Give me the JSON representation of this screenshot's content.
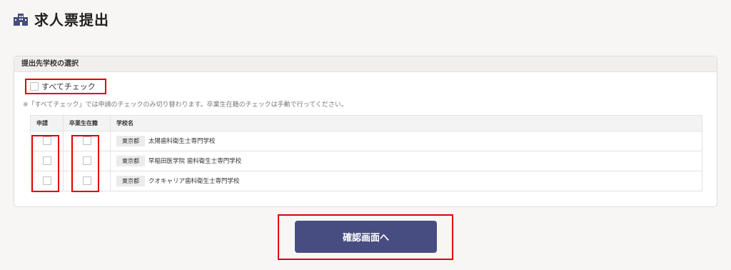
{
  "page": {
    "title": "求人票提出",
    "icon": "building-icon"
  },
  "panel": {
    "heading": "提出先学校の選択",
    "check_all_label": "すべてチェック",
    "note": "※「すべてチェック」では申請のチェックのみ切り替わります。卒業生在籍のチェックは手動で行ってください。"
  },
  "table": {
    "headers": {
      "apply": "申請",
      "graduate": "卒業生在籍",
      "school": "学校名"
    },
    "rows": [
      {
        "prefecture": "東京都",
        "school": "太陽歯科衛生士専門学校"
      },
      {
        "prefecture": "東京都",
        "school": "早稲田医学院 歯科衛生士専門学校"
      },
      {
        "prefecture": "東京都",
        "school": "クオキャリア歯科衛生士専門学校"
      }
    ]
  },
  "actions": {
    "confirm_label": "確認画面へ"
  },
  "colors": {
    "primary_button": "#474d80",
    "highlight": "#e00000"
  }
}
